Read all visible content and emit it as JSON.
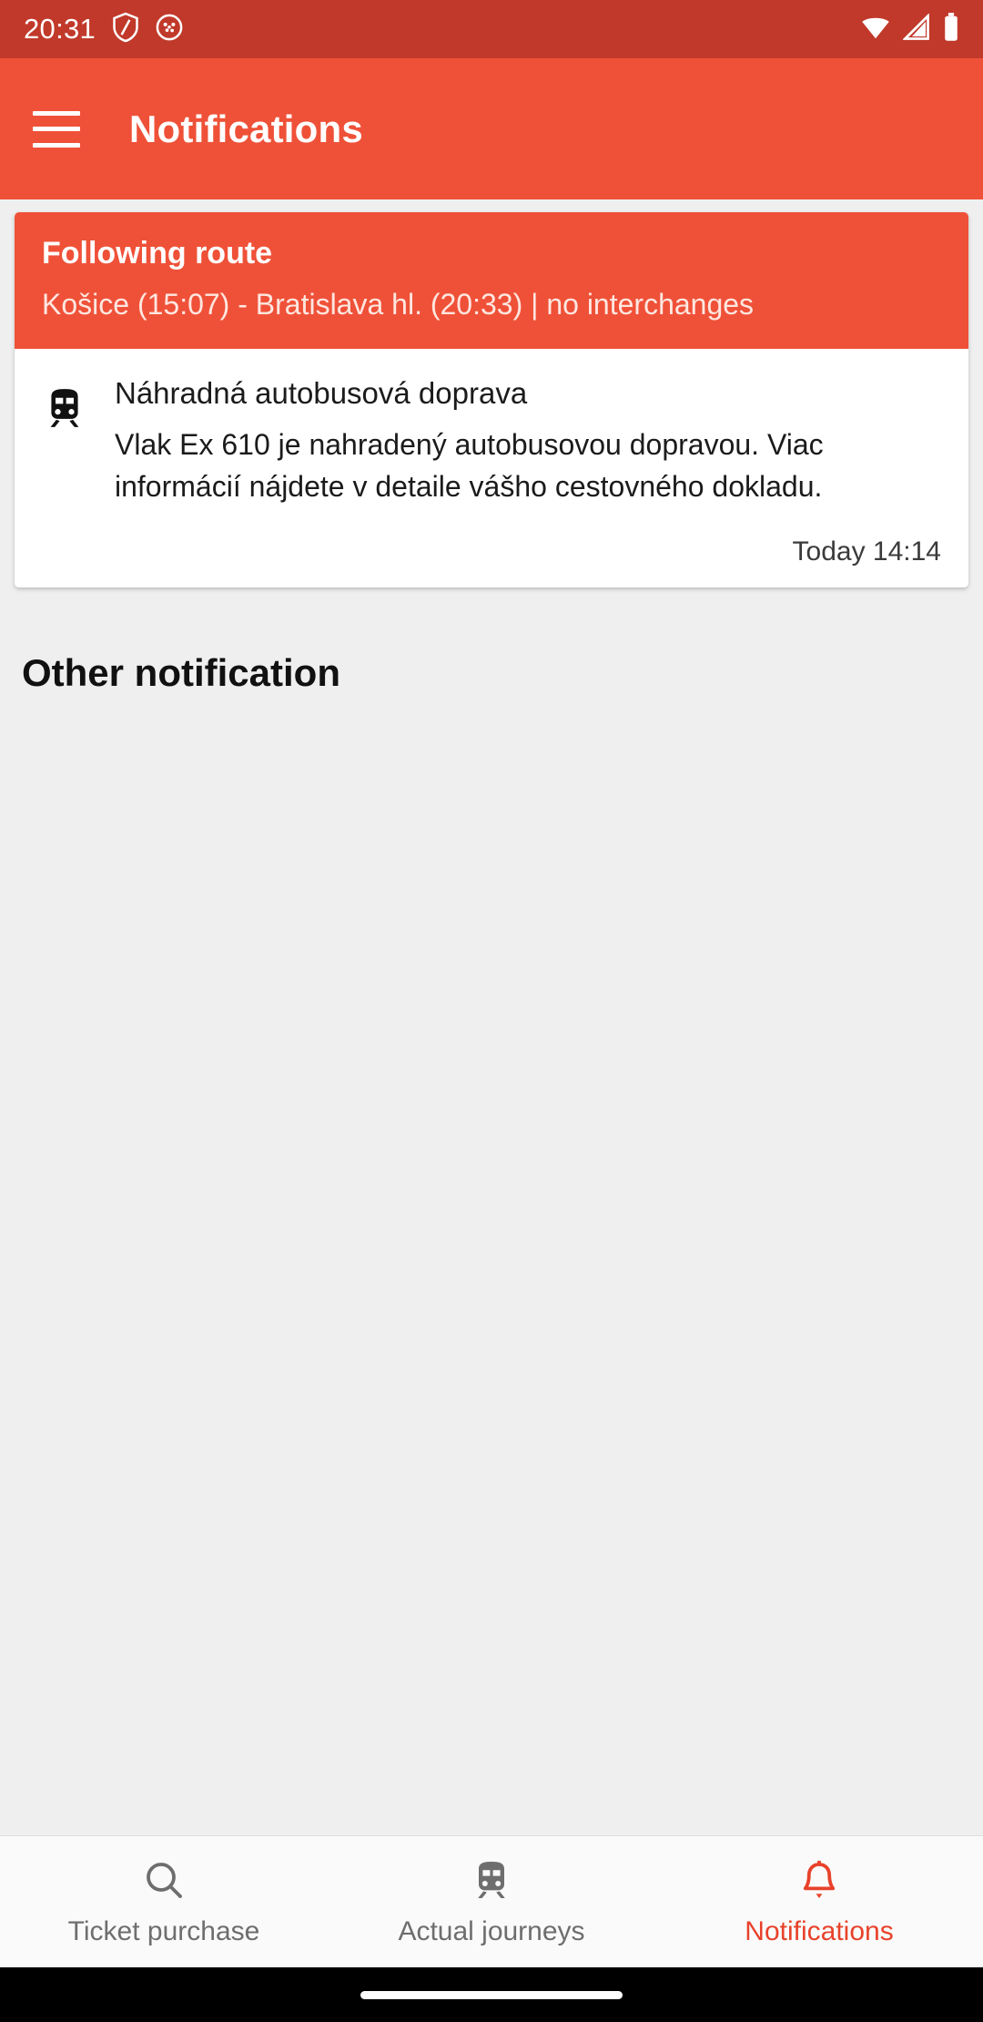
{
  "status_bar": {
    "time": "20:31",
    "left_icons": [
      "shield-icon",
      "app-badge-icon"
    ],
    "right_icons": [
      "wifi-icon",
      "cellular-signal-icon",
      "battery-icon"
    ],
    "background_color": "#c1392a",
    "foreground_color": "#ffffff"
  },
  "app_bar": {
    "menu_icon": "hamburger-menu-icon",
    "title": "Notifications",
    "background_color": "#ef5138",
    "text_color": "#ffffff"
  },
  "card": {
    "header": {
      "title": "Following route",
      "route": "Košice (15:07) - Bratislava hl. (20:33) | no interchanges",
      "background_color": "#ef5138"
    },
    "notification": {
      "icon": "train-icon",
      "title": "Náhradná autobusová doprava",
      "description": "Vlak Ex 610 je nahradený autobusovou dopravou. Viac informácií nájdete v detaile vášho cestovného dokladu.",
      "timestamp": "Today 14:14"
    }
  },
  "section": {
    "other_notification_title": "Other notification"
  },
  "bottom_nav": {
    "active_color": "#e8422b",
    "inactive_color": "#6e6e6e",
    "items": [
      {
        "label": "Ticket purchase",
        "icon": "search-icon",
        "active": false
      },
      {
        "label": "Actual journeys",
        "icon": "train-icon",
        "active": false
      },
      {
        "label": "Notifications",
        "icon": "bell-icon",
        "active": true
      }
    ]
  }
}
